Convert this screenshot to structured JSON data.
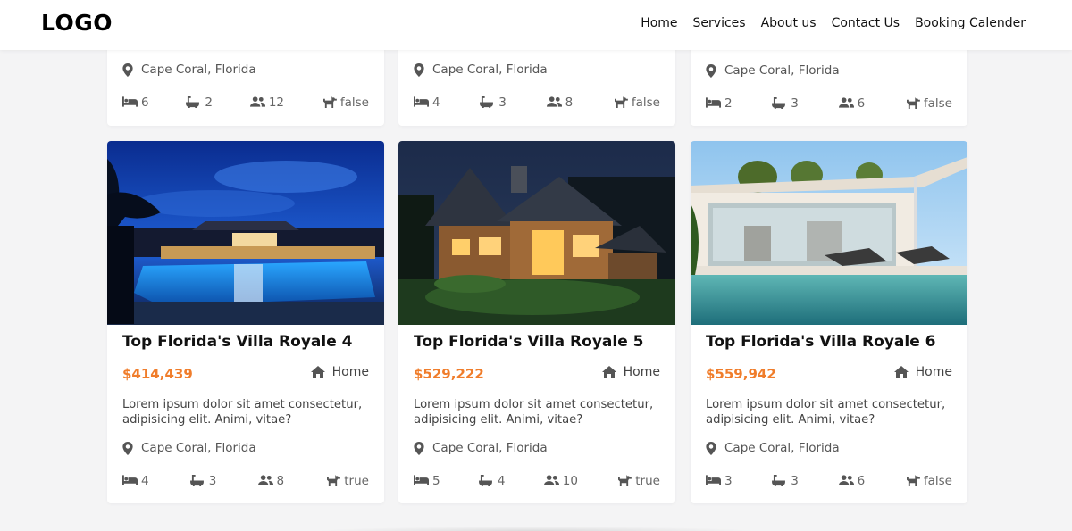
{
  "nav": {
    "logo": "LOGO",
    "links": [
      "Home",
      "Services",
      "About us",
      "Contact Us",
      "Booking Calender"
    ]
  },
  "top_cards": [
    {
      "location": "Cape Coral, Florida",
      "beds": "6",
      "baths": "2",
      "guests": "12",
      "pets": "false"
    },
    {
      "location": "Cape Coral, Florida",
      "beds": "4",
      "baths": "3",
      "guests": "8",
      "pets": "false"
    },
    {
      "location": "Cape Coral, Florida",
      "beds": "2",
      "baths": "3",
      "guests": "6",
      "pets": "false"
    }
  ],
  "cards": [
    {
      "title": "Top Florida's Villa Royale 4",
      "price": "$414,439",
      "type": "Home",
      "description": "Lorem ipsum dolor sit amet consectetur, adipisicing elit. Animi, vitae?",
      "location": "Cape Coral, Florida",
      "beds": "4",
      "baths": "3",
      "guests": "8",
      "pets": "true"
    },
    {
      "title": "Top Florida's Villa Royale 5",
      "price": "$529,222",
      "type": "Home",
      "description": "Lorem ipsum dolor sit amet consectetur, adipisicing elit. Animi, vitae?",
      "location": "Cape Coral, Florida",
      "beds": "5",
      "baths": "4",
      "guests": "10",
      "pets": "true"
    },
    {
      "title": "Top Florida's Villa Royale 6",
      "price": "$559,942",
      "type": "Home",
      "description": "Lorem ipsum dolor sit amet consectetur, adipisicing elit. Animi, vitae?",
      "location": "Cape Coral, Florida",
      "beds": "3",
      "baths": "3",
      "guests": "6",
      "pets": "false"
    }
  ],
  "icons": {
    "location": "map-pin-icon",
    "beds": "bed-icon",
    "baths": "bathtub-icon",
    "guests": "users-icon",
    "pets": "dog-icon",
    "type": "house-icon"
  },
  "colors": {
    "price": "#f07d2b",
    "background": "#f4f4f5",
    "card": "#ffffff"
  }
}
